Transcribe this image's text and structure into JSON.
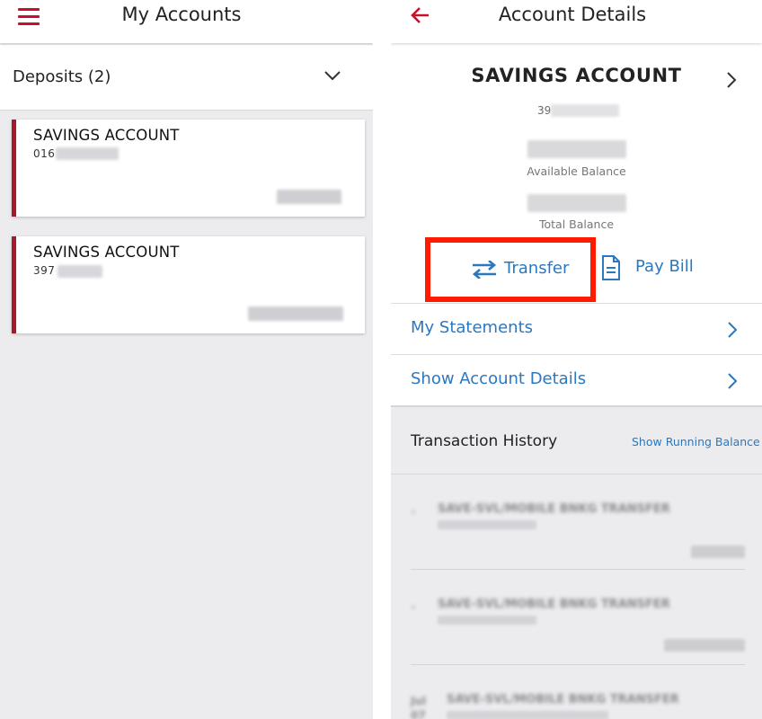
{
  "left_screen": {
    "title": "My Accounts",
    "deposits_label": "Deposits (2)",
    "accounts": [
      {
        "name": "SAVINGS ACCOUNT",
        "number_prefix": "016"
      },
      {
        "name": "SAVINGS ACCOUNT",
        "number_prefix": "397"
      }
    ]
  },
  "right_screen": {
    "title": "Account Details",
    "account_name": "SAVINGS ACCOUNT",
    "account_number_prefix": "39",
    "available_balance_label": "Available Balance",
    "total_balance_label": "Total Balance",
    "actions": {
      "transfer": "Transfer",
      "pay_bill": "Pay Bill"
    },
    "menu": {
      "statements": "My Statements",
      "account_details": "Show Account Details"
    },
    "history": {
      "title": "Transaction History",
      "running_balance_link": "Show Running Balance",
      "rows": [
        {
          "description": "SAVE-SVL/MOBILE BNKG TRANSFER"
        },
        {
          "description": "SAVE-SVL/MOBILE BNKG TRANSFER"
        },
        {
          "description": "SAVE-SVL/MOBILE BNKG TRANSFER",
          "date_day": "Jul",
          "date_num": "07"
        }
      ]
    }
  },
  "colors": {
    "brand_red": "#c8102e",
    "accent_blue": "#2a78c0",
    "highlight_red": "#ff1a00"
  },
  "icons": [
    "hamburger-menu-icon",
    "chevron-down-icon",
    "back-arrow-icon",
    "chevron-right-icon",
    "transfer-arrows-icon",
    "document-icon"
  ]
}
